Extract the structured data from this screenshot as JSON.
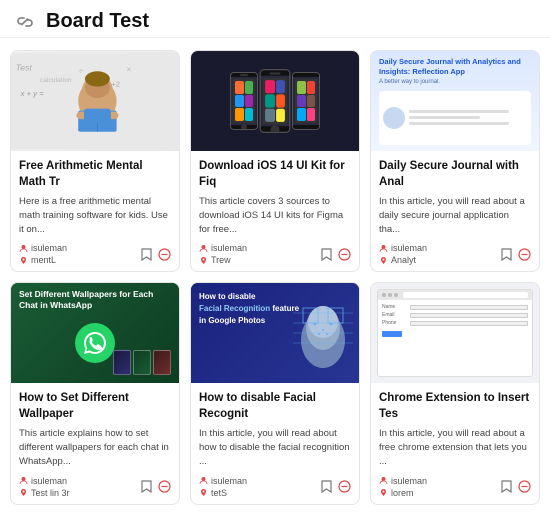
{
  "header": {
    "title": "Board Test",
    "link_icon_label": "link-icon"
  },
  "cards": [
    {
      "id": "card-1",
      "image_type": "math",
      "title": "Free Arithmetic Mental Math Tr",
      "description": "Here is a free arithmetic mental math training software for kids. Use it on...",
      "author": "isuleman",
      "tag": "mentL",
      "image_alt": "Arithmetic mental math"
    },
    {
      "id": "card-2",
      "image_type": "ios",
      "title": "Download iOS 14 UI Kit for Fiq",
      "description": "This article covers 3 sources to download iOS 14 UI kits for Figma for free...",
      "author": "isuleman",
      "tag": "Trew",
      "image_alt": "iOS 14 UI kit"
    },
    {
      "id": "card-3",
      "image_type": "journal",
      "title": "Daily Secure Journal with Anal",
      "description": "In this article, you will read about a daily secure journal application tha...",
      "author": "isuleman",
      "tag": "Analyt",
      "image_alt": "Daily secure journal"
    },
    {
      "id": "card-4",
      "image_type": "whatsapp",
      "title": "How to Set Different Wallpaper",
      "description": "This article explains how to set different wallpapers for each chat in WhatsApp...",
      "author": "isuleman",
      "tag": "Test lin 3r",
      "image_alt": "WhatsApp wallpaper"
    },
    {
      "id": "card-5",
      "image_type": "facial",
      "title": "How to disable Facial Recognit",
      "description": "In this article, you will read about how to disable the facial recognition ...",
      "author": "isuleman",
      "tag": "tetS",
      "image_alt": "Facial recognition"
    },
    {
      "id": "card-6",
      "image_type": "chrome",
      "title": "Chrome Extension to Insert Tes",
      "description": "In this article, you will read about a free chrome extension that lets you ...",
      "author": "isuleman",
      "tag": "lorem",
      "image_alt": "Chrome extension"
    }
  ],
  "icons": {
    "bookmark": "🔖",
    "minus_circle": "⊖",
    "person": "👤",
    "tag": "🏷",
    "link": "🔗"
  },
  "journal_header": "Daily Secure Journal with Analytics and Insights: Reflection App",
  "journal_sub": "A better way to journal.",
  "whatsapp_title": "Set Different Wallpapers for Each Chat in WhatsApp",
  "facial_title_line1": "How to disable",
  "facial_title_line2": "Facial Recognition",
  "facial_title_line3": "feature",
  "facial_title_line4": "in Google Photos"
}
